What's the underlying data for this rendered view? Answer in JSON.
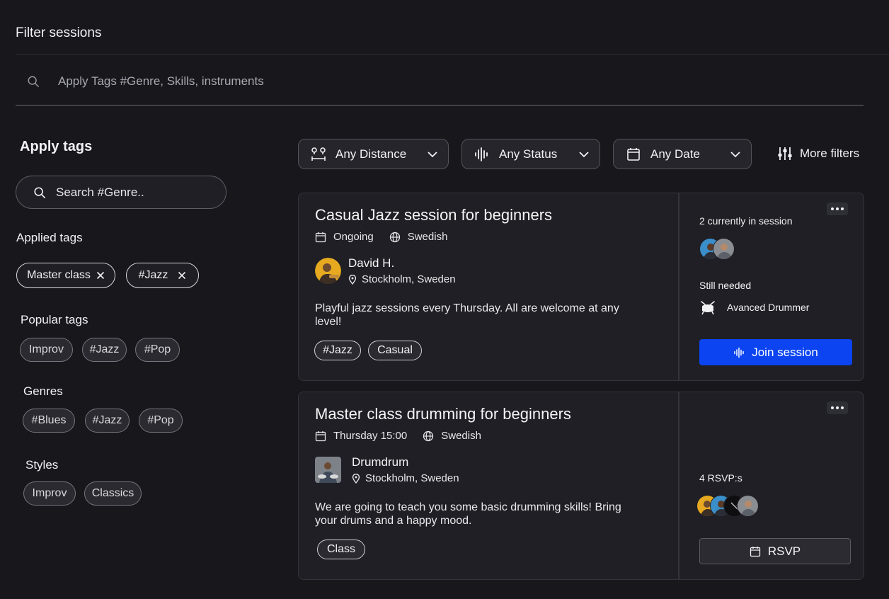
{
  "header": {
    "title": "Filter sessions",
    "search_placeholder": "Apply Tags #Genre, Skills, instruments"
  },
  "sidebar": {
    "title": "Apply tags",
    "search_placeholder": "Search #Genre..",
    "applied_heading": "Applied tags",
    "applied_tags": [
      "Master class",
      "#Jazz"
    ],
    "popular_heading": "Popular tags",
    "popular_tags": [
      "Improv",
      "#Jazz",
      "#Pop"
    ],
    "genres_heading": "Genres",
    "genres": [
      "#Blues",
      "#Jazz",
      "#Pop"
    ],
    "styles_heading": "Styles",
    "styles": [
      "Improv",
      "Classics"
    ]
  },
  "filters": {
    "distance": "Any Distance",
    "status": "Any Status",
    "date": "Any Date",
    "more": "More filters"
  },
  "sessions": [
    {
      "title": "Casual Jazz session for beginners",
      "when": "Ongoing",
      "language": "Swedish",
      "host": "David H.",
      "location": "Stockholm, Sweden",
      "description": "Playful jazz sessions every Thursday. All are welcome at any level!",
      "tags": [
        "#Jazz",
        "Casual"
      ],
      "participants_label": "2 currently in session",
      "needed_label": "Still needed",
      "needed_role": "Avanced Drummer",
      "action": "Join session"
    },
    {
      "title": "Master class drumming for beginners",
      "when": "Thursday 15:00",
      "language": "Swedish",
      "host": "Drumdrum",
      "location": "Stockholm, Sweden",
      "description": "We are going to teach you some basic drumming skills! Bring your drums and a happy mood.",
      "tags": [
        "Class"
      ],
      "participants_label": "4 RSVP:s",
      "action": "RSVP"
    }
  ],
  "colors": {
    "background": "#17171c",
    "card": "#1f1f25",
    "accent": "#0b44f0"
  }
}
